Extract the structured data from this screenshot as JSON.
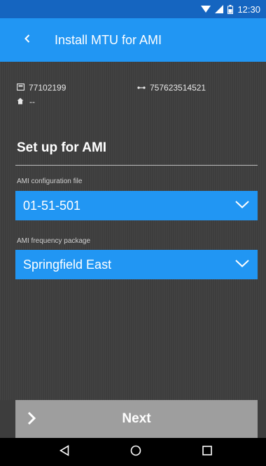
{
  "status_bar": {
    "time": "12:30"
  },
  "app_bar": {
    "title": "Install MTU for AMI"
  },
  "info": {
    "meter_id": "77102199",
    "mtu_id": "757623514521",
    "address": "--"
  },
  "section": {
    "title": "Set up for AMI"
  },
  "fields": [
    {
      "label": "AMI configuration file",
      "value": "01-51-501"
    },
    {
      "label": "AMI frequency package",
      "value": "Springfield East"
    }
  ],
  "actions": {
    "next_label": "Next"
  },
  "colors": {
    "app_bar": "#2196f3",
    "status_bar": "#1565c0",
    "background": "#3d3d3d",
    "select_field": "#2196f3",
    "next_button": "#9e9e9e"
  }
}
